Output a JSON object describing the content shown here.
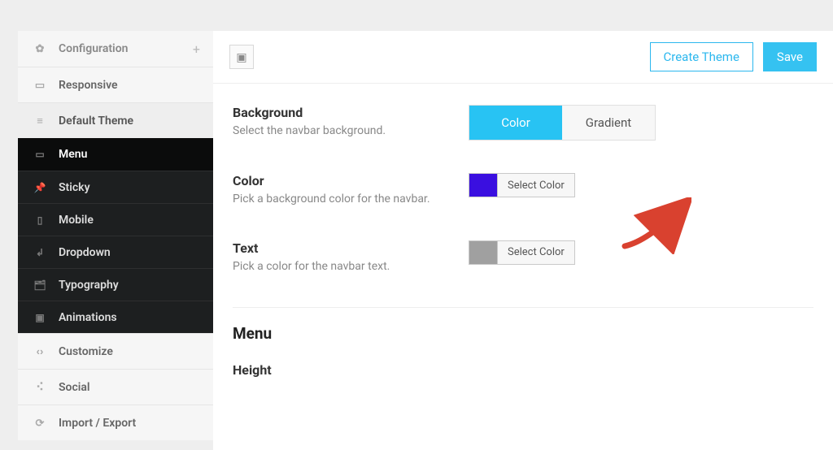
{
  "topbar": {
    "create_theme": "Create Theme",
    "save": "Save"
  },
  "sidebar": {
    "configuration": "Configuration",
    "responsive": "Responsive",
    "default_theme": "Default Theme",
    "sub": {
      "menu": "Menu",
      "sticky": "Sticky",
      "mobile": "Mobile",
      "dropdown": "Dropdown",
      "typography": "Typography",
      "animations": "Animations"
    },
    "customize": "Customize",
    "social": "Social",
    "import_export": "Import / Export"
  },
  "fields": {
    "background": {
      "title": "Background",
      "desc": "Select the navbar background.",
      "opt_color": "Color",
      "opt_gradient": "Gradient"
    },
    "color": {
      "title": "Color",
      "desc": "Pick a background color for the navbar.",
      "select": "Select Color",
      "swatch": "#3a0fe0"
    },
    "text": {
      "title": "Text",
      "desc": "Pick a color for the navbar text.",
      "select": "Select Color",
      "swatch": "#a0a0a0"
    }
  },
  "sections": {
    "menu": "Menu",
    "height": "Height"
  }
}
